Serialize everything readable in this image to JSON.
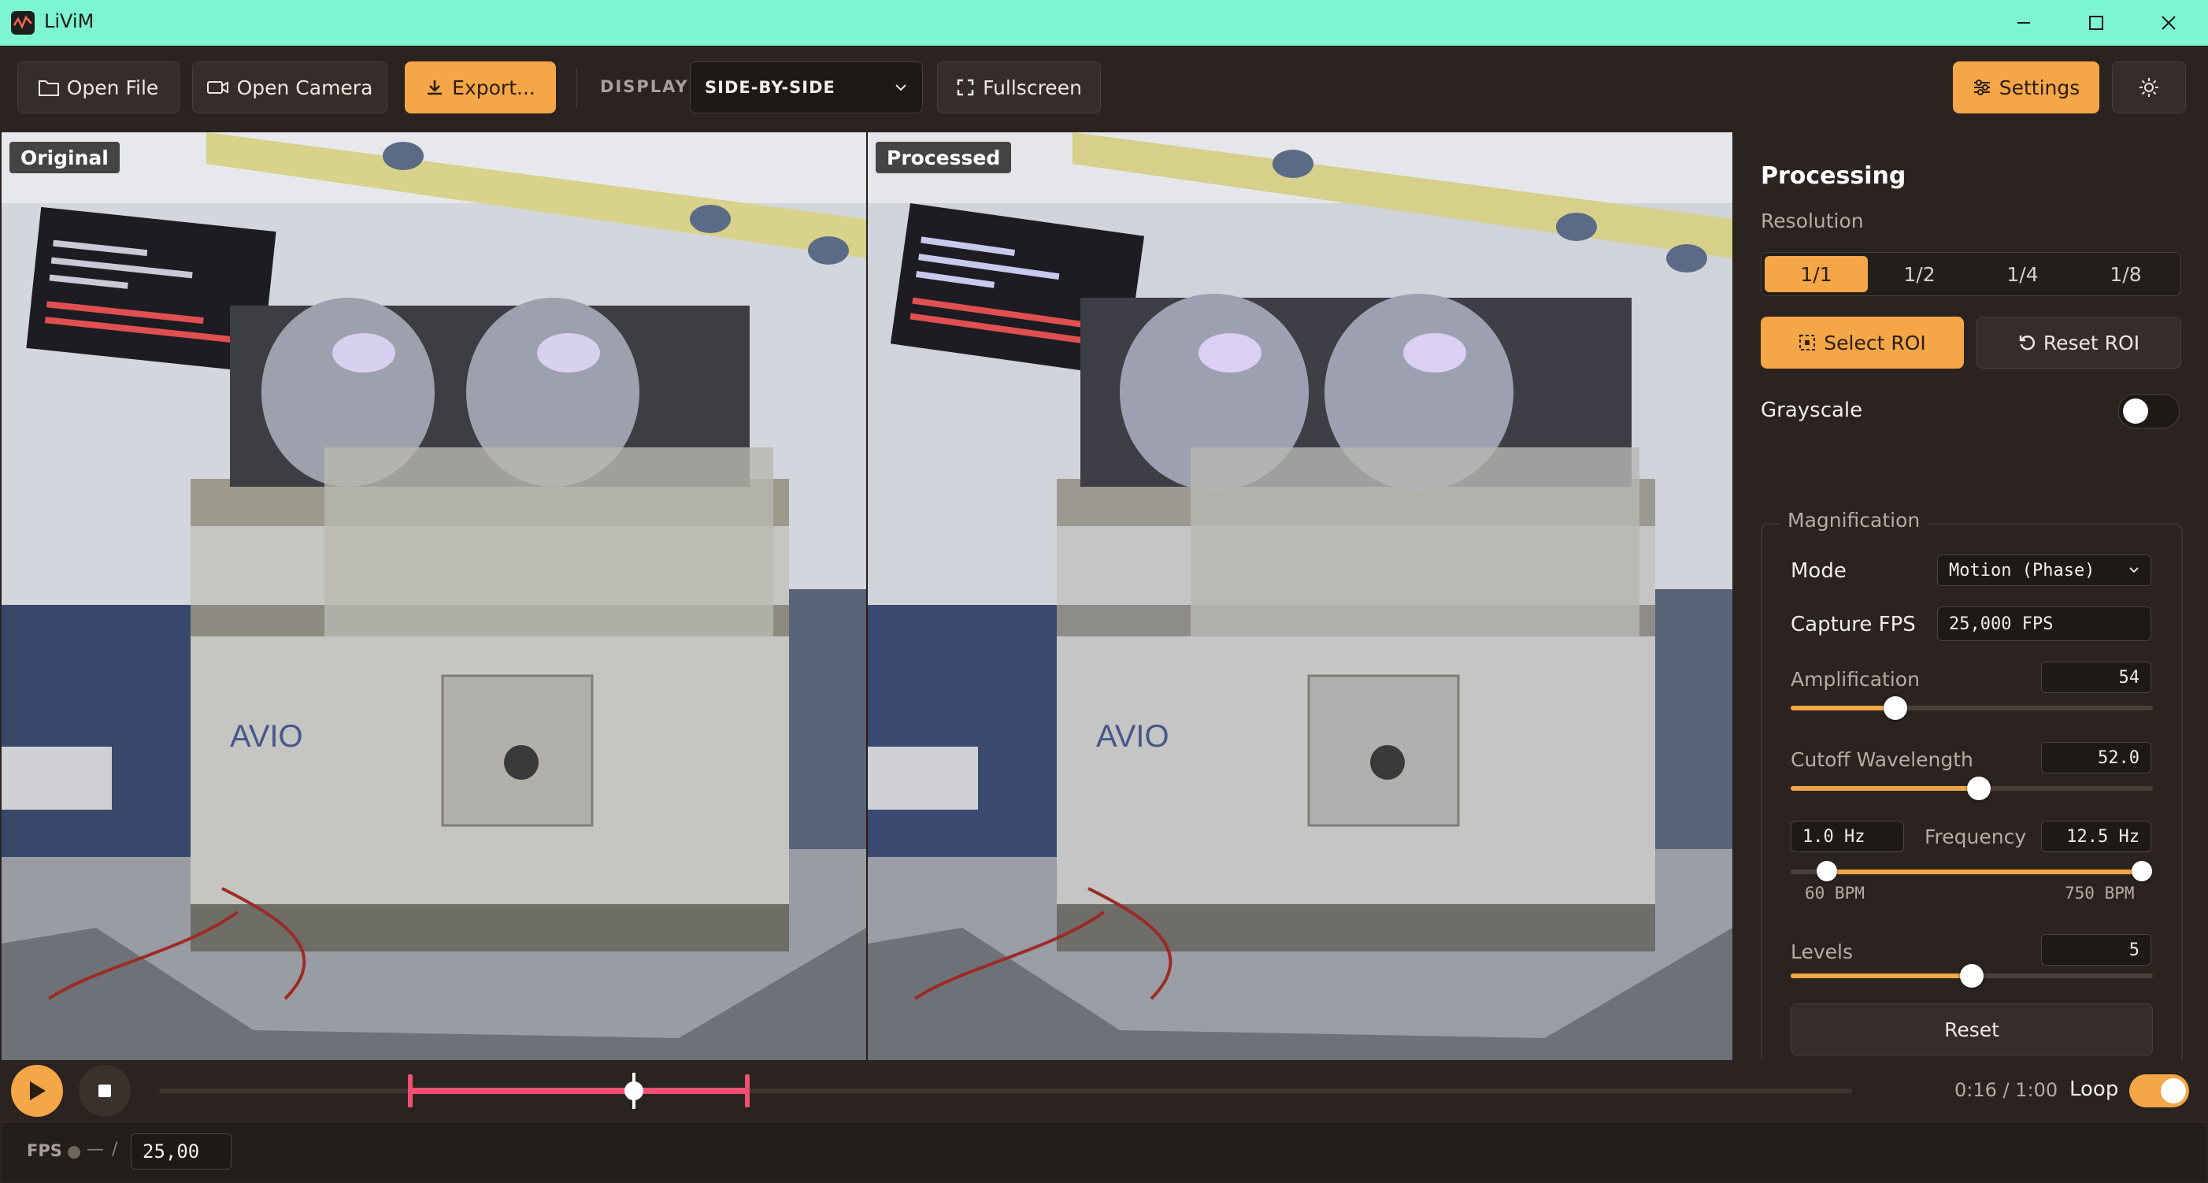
{
  "app": {
    "title": "LiViM"
  },
  "toolbar": {
    "open_file": "Open File",
    "open_camera": "Open Camera",
    "export": "Export...",
    "display_label": "DISPLAY",
    "display_value": "SIDE-BY-SIDE",
    "fullscreen": "Fullscreen",
    "settings": "Settings"
  },
  "video": {
    "original_label": "Original",
    "processed_label": "Processed"
  },
  "panel": {
    "title": "Processing",
    "resolution_label": "Resolution",
    "resolution_options": [
      "1/1",
      "1/2",
      "1/4",
      "1/8"
    ],
    "resolution_selected": "1/1",
    "select_roi": "Select ROI",
    "reset_roi": "Reset ROI",
    "grayscale_label": "Grayscale",
    "grayscale_on": false,
    "magnification": {
      "legend": "Magnification",
      "mode_label": "Mode",
      "mode_value": "Motion (Phase)",
      "capture_fps_label": "Capture FPS",
      "capture_fps_value": "25,000 FPS",
      "amplification_label": "Amplification",
      "amplification_value": "54",
      "amplification_fraction": 0.29,
      "cutoff_label": "Cutoff Wavelength",
      "cutoff_value": "52.0",
      "cutoff_fraction": 0.52,
      "freq_low": "1.0 Hz",
      "frequency_label": "Frequency",
      "freq_high": "12.5 Hz",
      "freq_low_fraction": 0.1,
      "freq_high_fraction": 0.97,
      "bpm_low": "60 BPM",
      "bpm_high": "750 BPM",
      "levels_label": "Levels",
      "levels_value": "5",
      "levels_fraction": 0.5,
      "reset": "Reset"
    }
  },
  "timeline": {
    "time": "0:16 / 1:00",
    "loop_label": "Loop",
    "loop_on": true
  },
  "status": {
    "fps_label": "FPS",
    "fps_dash": "—",
    "fps_slash": "/",
    "fps_value": "25,00"
  },
  "colors": {
    "accent": "#f5a646",
    "titlebar": "#7cf5d0",
    "trim_range": "#ef4f72"
  }
}
